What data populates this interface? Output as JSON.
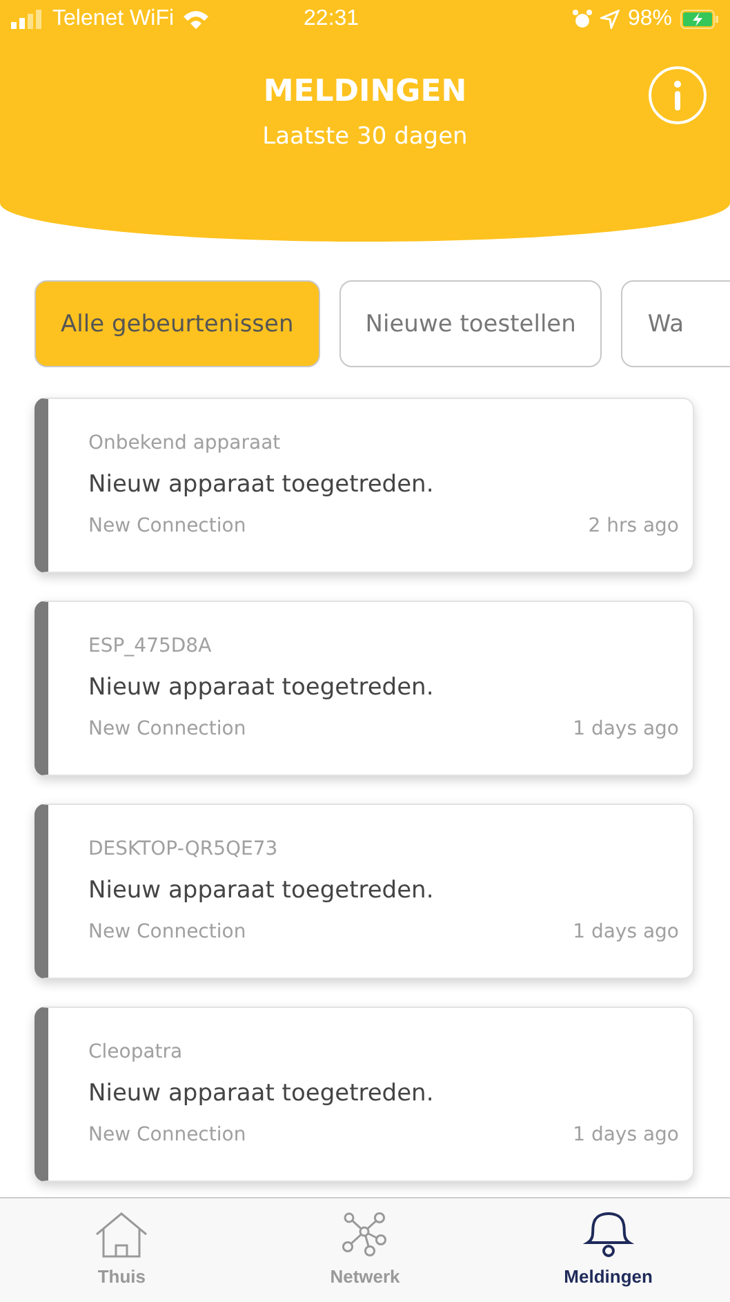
{
  "status_bar": {
    "carrier": "Telenet WiFi",
    "time": "22:31",
    "battery": "98%"
  },
  "header": {
    "title": "MELDINGEN",
    "subtitle": "Laatste 30 dagen"
  },
  "filters": [
    {
      "label": "Alle gebeurtenissen",
      "selected": true
    },
    {
      "label": "Nieuwe toestellen",
      "selected": false
    },
    {
      "label": "Wa",
      "selected": false
    }
  ],
  "notifications": [
    {
      "device": "Onbekend apparaat",
      "message": "Nieuw apparaat toegetreden.",
      "type": "New Connection",
      "time": "2 hrs ago"
    },
    {
      "device": "ESP_475D8A",
      "message": "Nieuw apparaat toegetreden.",
      "type": "New Connection",
      "time": "1 days ago"
    },
    {
      "device": "DESKTOP-QR5QE73",
      "message": "Nieuw apparaat toegetreden.",
      "type": "New Connection",
      "time": "1 days ago"
    },
    {
      "device": "Cleopatra",
      "message": "Nieuw apparaat toegetreden.",
      "type": "New Connection",
      "time": "1 days ago"
    }
  ],
  "tab_bar": [
    {
      "label": "Thuis",
      "kind": "home",
      "selected": false
    },
    {
      "label": "Netwerk",
      "kind": "network",
      "selected": false
    },
    {
      "label": "Meldingen",
      "kind": "bell",
      "selected": true
    }
  ]
}
